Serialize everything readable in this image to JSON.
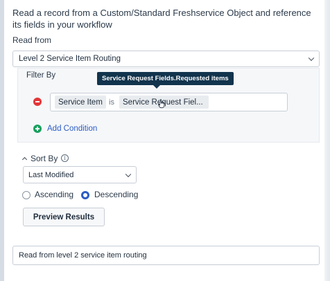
{
  "description": "Read a record from a Custom/Standard Freshservice Object and reference its fields in your workflow",
  "read_from": {
    "label": "Read from",
    "selected": "Level 2 Service Item Routing",
    "icon": "chevron-down-icon"
  },
  "filter": {
    "title": "Filter By",
    "tooltip": "Service Request Fields.Requested items",
    "condition": {
      "field": "Service Item",
      "operator": "is",
      "value": "Service Request Fiel..."
    },
    "add_condition_label": "Add Condition",
    "remove_icon": "minus-circle-icon",
    "add_icon": "plus-circle-icon"
  },
  "sort": {
    "label": "Sort By",
    "info_icon": "info-icon",
    "selected": "Last Modified",
    "options": [
      {
        "label": "Ascending",
        "checked": false
      },
      {
        "label": "Descending",
        "checked": true
      }
    ]
  },
  "preview_button": "Preview Results",
  "name_field": {
    "value": "Read from level 2 service item routing"
  },
  "colors": {
    "accent": "#2c5cc5",
    "tooltip_bg": "#12344d",
    "remove": "#e43538",
    "add": "#18a05e"
  }
}
